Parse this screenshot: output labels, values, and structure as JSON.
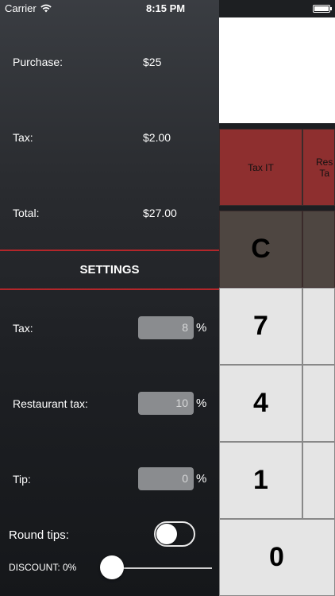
{
  "status_bar": {
    "carrier": "Carrier",
    "time": "8:15 PM"
  },
  "summary": {
    "purchase_label": "Purchase:",
    "purchase_value": "$25",
    "tax_label": "Tax:",
    "tax_value": "$2.00",
    "total_label": "Total:",
    "total_value": "$27.00"
  },
  "settings": {
    "title": "SETTINGS",
    "tax_label": "Tax:",
    "tax_value": "8",
    "restaurant_tax_label": "Restaurant tax:",
    "restaurant_tax_value": "10",
    "tip_label": "Tip:",
    "tip_value": "0",
    "percent_sign": "%",
    "round_tips_label": "Round tips:",
    "round_tips_on": false,
    "discount_label": "DISCOUNT: 0%",
    "discount_fraction": 0
  },
  "keypad": {
    "tax_it": "Tax IT",
    "restaurant_tax_partial": "Res\nTa",
    "clear": "C",
    "seven": "7",
    "four": "4",
    "one": "1",
    "zero": "0"
  },
  "colors": {
    "accent_red": "#b3262a",
    "tax_key": "#8e2f2f",
    "clear_key": "#4e4641",
    "num_key": "#e5e5e5"
  }
}
